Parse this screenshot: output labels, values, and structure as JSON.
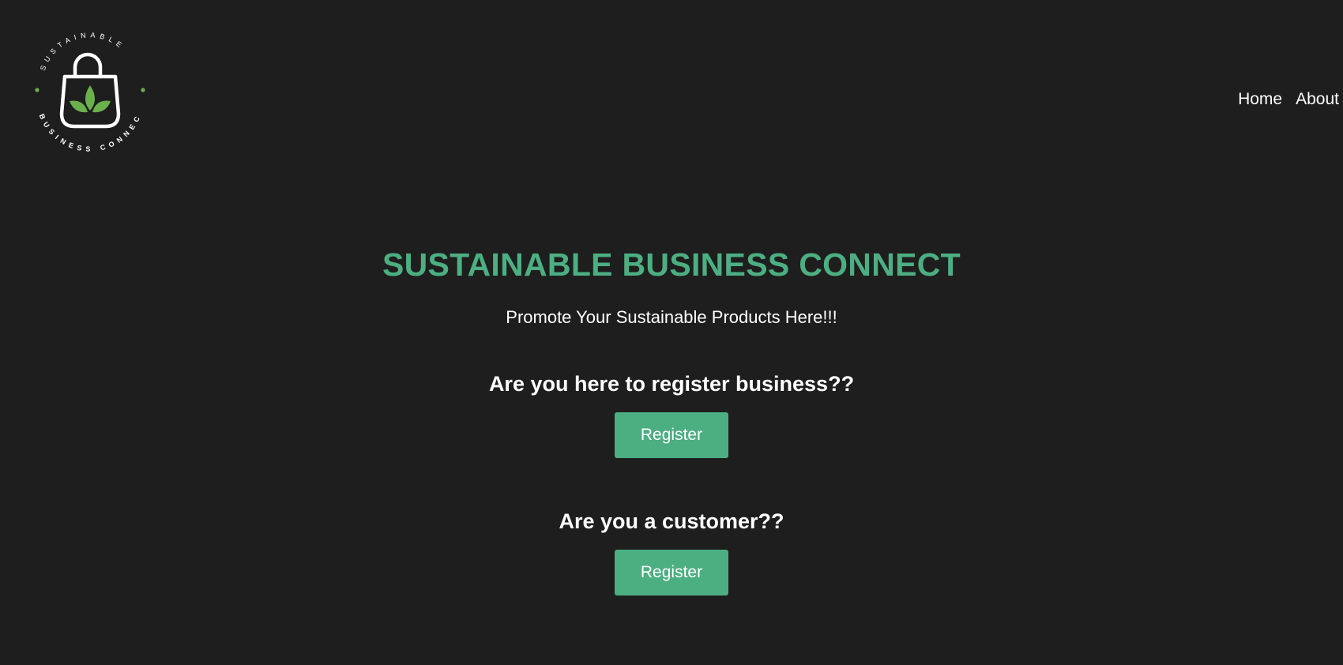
{
  "logo": {
    "top_text": "SUSTAINABLE",
    "bottom_text": "BUSINESS CONNECT",
    "leaf_color": "#6ab04c",
    "dot_color": "#6ab04c"
  },
  "nav": {
    "items": [
      {
        "label": "Home"
      },
      {
        "label": "About"
      }
    ]
  },
  "hero": {
    "title": "SUSTAINABLE BUSINESS CONNECT",
    "subtitle": "Promote Your Sustainable Products Here!!!"
  },
  "business": {
    "question": "Are you here to register business??",
    "button_label": "Register"
  },
  "customer": {
    "question": "Are you a customer??",
    "button_label": "Register"
  },
  "colors": {
    "background": "#1e1e1e",
    "accent": "#4caf82"
  }
}
